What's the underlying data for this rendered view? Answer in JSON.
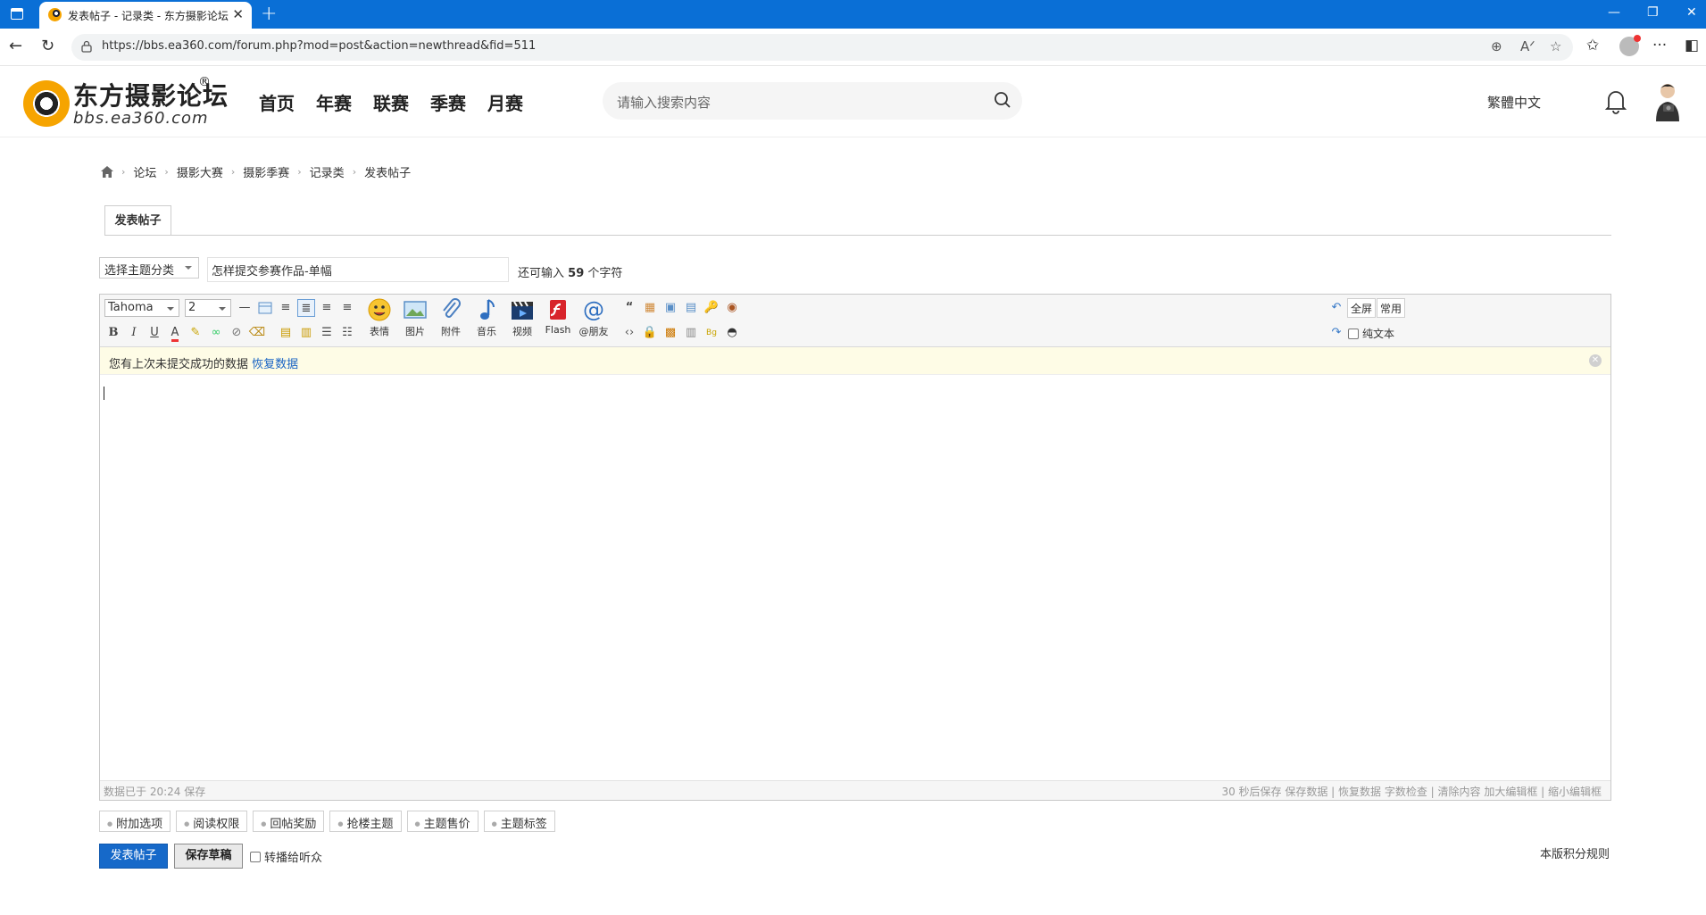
{
  "browser": {
    "tab_title": "发表帖子 - 记录类 - 东方摄影论坛",
    "url": "https://bbs.ea360.com/forum.php?mod=post&action=newthread&fid=511"
  },
  "site": {
    "logo_name": "东方摄影论坛",
    "logo_reg": "®",
    "logo_domain": "bbs.ea360.com",
    "nav": [
      "首页",
      "年赛",
      "联赛",
      "季赛",
      "月赛"
    ],
    "search_placeholder": "请输入搜索内容",
    "lang_switch": "繁體中文"
  },
  "breadcrumb": [
    "论坛",
    "摄影大赛",
    "摄影季赛",
    "记录类",
    "发表帖子"
  ],
  "form": {
    "tab_label": "发表帖子",
    "category_select": "选择主题分类",
    "subject_value": "怎样提交参赛作品-单幅",
    "char_hint_prefix": "还可输入",
    "char_hint_count": "59",
    "char_hint_suffix": "个字符"
  },
  "editor": {
    "font": "Tahoma",
    "size": "2",
    "big_buttons": [
      {
        "name": "emoticon",
        "label": "表情"
      },
      {
        "name": "image",
        "label": "图片"
      },
      {
        "name": "attachment",
        "label": "附件"
      },
      {
        "name": "music",
        "label": "音乐"
      },
      {
        "name": "video",
        "label": "视频"
      },
      {
        "name": "flash",
        "label": "Flash"
      },
      {
        "name": "mention",
        "label": "@朋友"
      }
    ],
    "fullscreen": "全屏",
    "common": "常用",
    "plain_text": "纯文本",
    "restore_text": "您有上次未提交成功的数据",
    "restore_link": "恢复数据",
    "status_saved": "数据已于 20:24 保存",
    "status_right": "30 秒后保存 保存数据 | 恢复数据    字数检查 | 清除内容    加大编辑框 | 缩小编辑框"
  },
  "options": [
    "附加选项",
    "阅读权限",
    "回帖奖励",
    "抢楼主题",
    "主题售价",
    "主题标签"
  ],
  "actions": {
    "submit": "发表帖子",
    "draft": "保存草稿",
    "relay": "转播给听众",
    "rules": "本版积分规则"
  }
}
